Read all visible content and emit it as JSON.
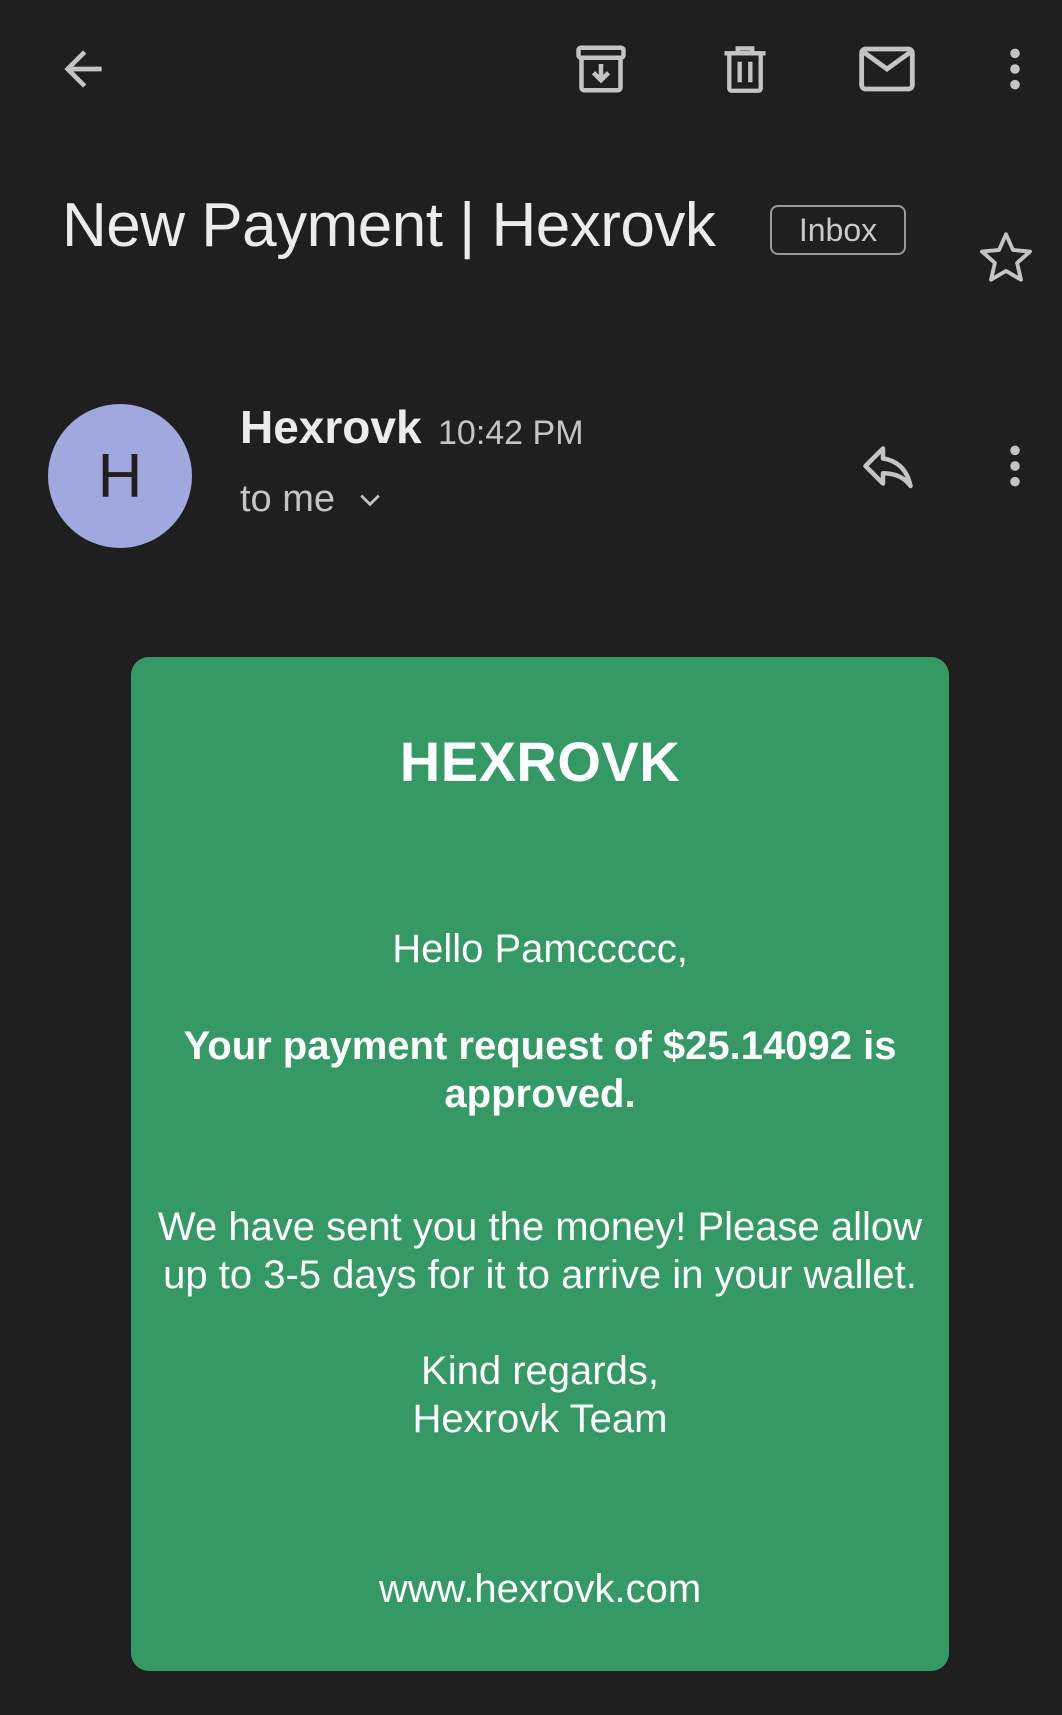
{
  "toolbar": {
    "back_icon": "arrow-left-icon",
    "archive_icon": "archive-icon",
    "delete_icon": "trash-icon",
    "mark_unread_icon": "mail-icon",
    "more_icon": "more-vertical-icon"
  },
  "email": {
    "subject": "New Payment | Hexrovk",
    "label": "Inbox",
    "star_icon": "star-outline-icon",
    "sender": {
      "avatar_letter": "H",
      "avatar_color": "#a1a8e0",
      "name": "Hexrovk",
      "time": "10:42 PM",
      "recipient": "to me"
    },
    "actions": {
      "reply_icon": "reply-icon",
      "more_icon": "more-vertical-icon"
    },
    "body": {
      "background_color": "#359966",
      "brand": "HEXROVK",
      "greeting": "Hello Pamccccc,",
      "approved_line": "Your payment request of $25.14092 is approved.",
      "message": "We have sent you the money! Please allow up to 3-5 days for it to arrive in your wallet.",
      "signoff_line1": "Kind regards,",
      "signoff_line2": "Hexrovk Team",
      "website": "www.hexrovk.com"
    }
  }
}
